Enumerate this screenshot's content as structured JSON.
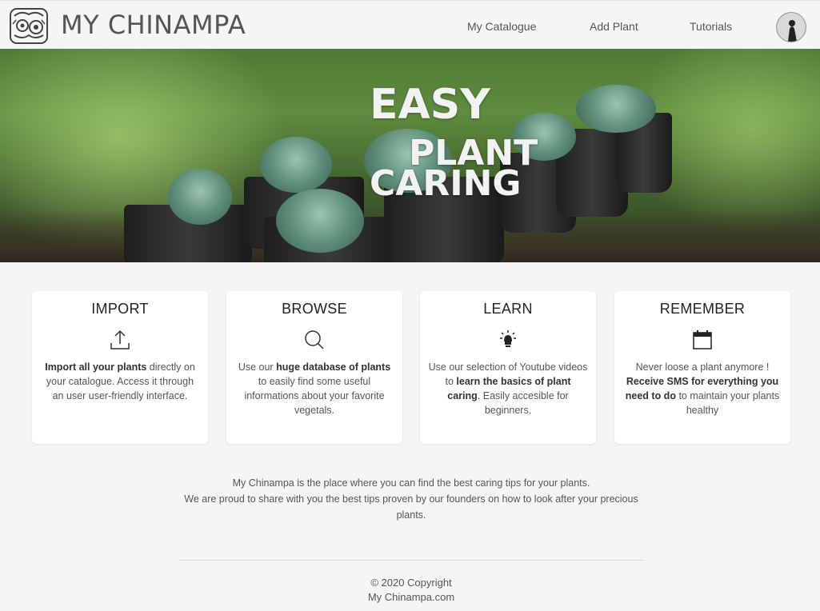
{
  "header": {
    "brand": "MY CHINAMPA",
    "nav": {
      "catalogue": "My Catalogue",
      "add_plant": "Add Plant",
      "tutorials": "Tutorials"
    }
  },
  "hero": {
    "line1": "EASY",
    "line2": "PLANT",
    "line3": "CARING"
  },
  "cards": [
    {
      "title": "IMPORT",
      "icon": "upload-icon",
      "bold1": "Import all your plants",
      "text1": " directly on your catalogue. Access it through an user user-friendly interface."
    },
    {
      "title": "BROWSE",
      "icon": "search-icon",
      "text0": "Use our ",
      "bold1": "huge database of plants",
      "text1": " to easily find some useful informations about your favorite vegetals."
    },
    {
      "title": "LEARN",
      "icon": "lightbulb-icon",
      "text0": "Use our selection of Youtube videos to ",
      "bold1": "learn the basics of plant caring",
      "text1": ". Easily accesible for beginners."
    },
    {
      "title": "REMEMBER",
      "icon": "calendar-icon",
      "text0": "Never loose a plant anymore ! ",
      "bold1": "Receive SMS for everything you need to do",
      "text1": " to maintain your plants healthy"
    }
  ],
  "about": {
    "line1": "My Chinampa is the place where you can find the best caring tips for your plants.",
    "line2": "We are proud to share with you the best tips proven by our founders on how to look after your precious plants."
  },
  "footer": {
    "copyright": "© 2020 Copyright",
    "site": "My Chinampa.com"
  }
}
